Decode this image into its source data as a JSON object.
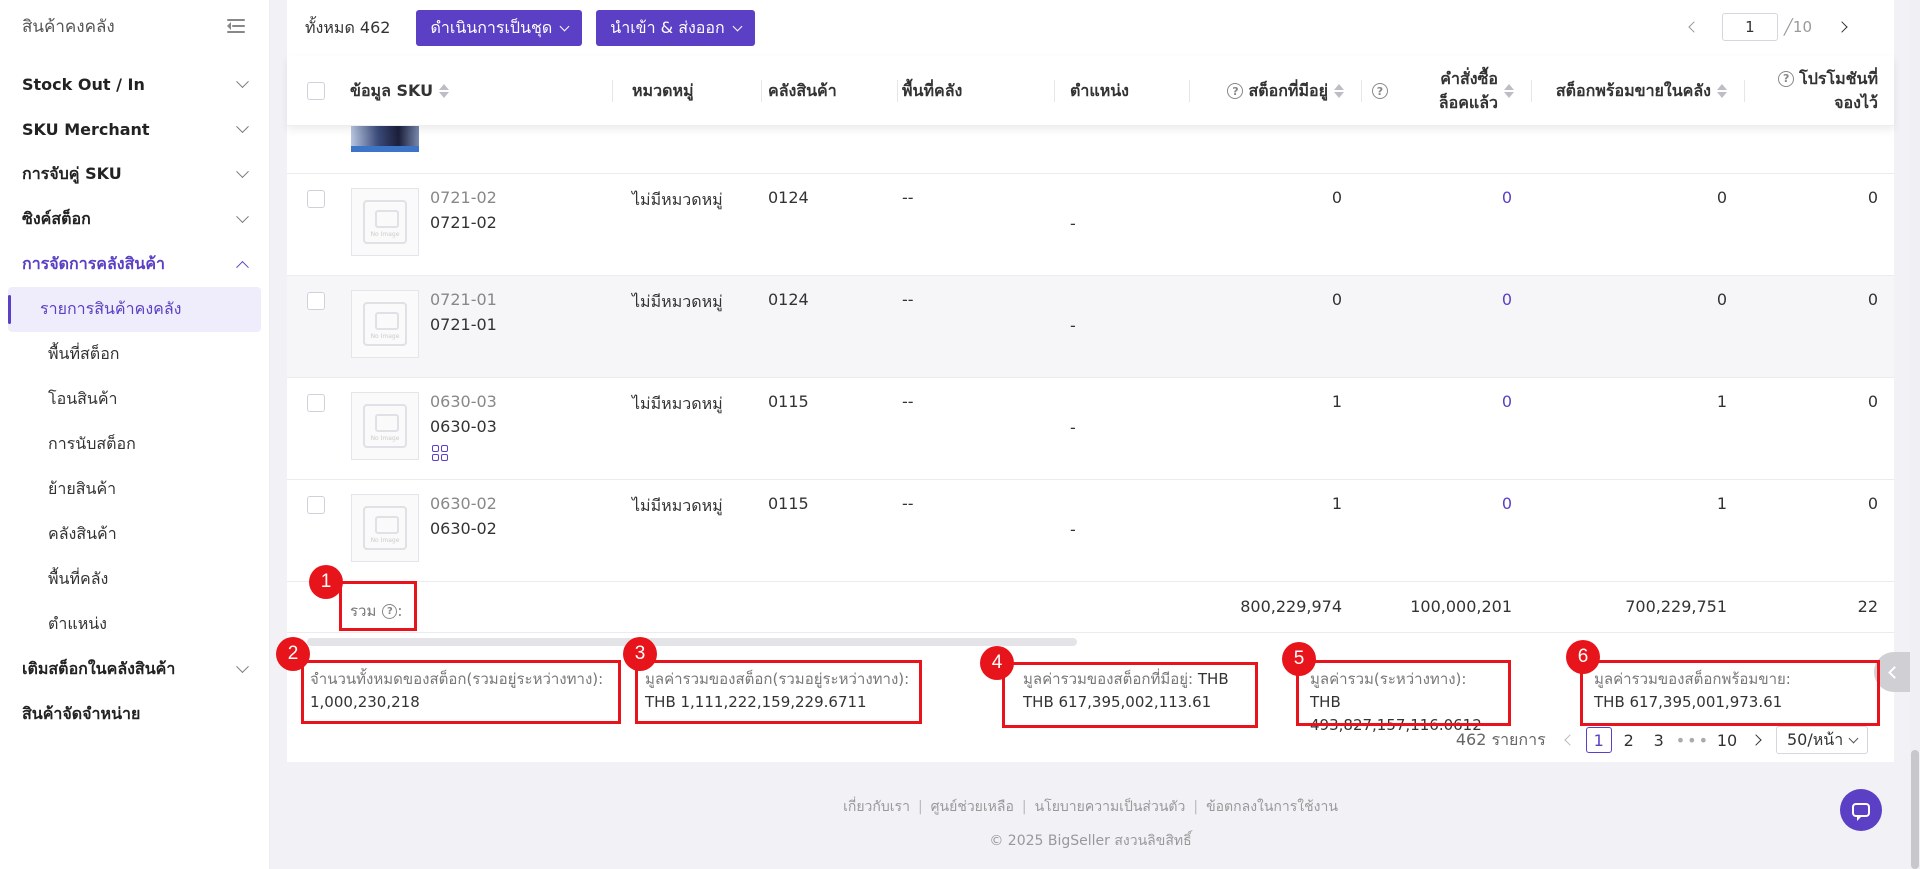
{
  "sidebar": {
    "title": "สินค้าคงคลัง",
    "groups": [
      {
        "label": "Stock Out / In"
      },
      {
        "label": "SKU Merchant"
      },
      {
        "label": "การจับคู่ SKU"
      },
      {
        "label": "ซิงค์สต็อก"
      },
      {
        "label": "การจัดการคลังสินค้า"
      }
    ],
    "sub_items": [
      {
        "label": "รายการสินค้าคงคลัง"
      },
      {
        "label": "พื้นที่สต็อก"
      },
      {
        "label": "โอนสินค้า"
      },
      {
        "label": "การนับสต็อก"
      },
      {
        "label": "ย้ายสินค้า"
      },
      {
        "label": "คลังสินค้า"
      },
      {
        "label": "พื้นที่คลัง"
      },
      {
        "label": "ตำแหน่ง"
      }
    ],
    "after_groups": [
      {
        "label": "เติมสต็อกในคลังสินค้า"
      },
      {
        "label": "สินค้าจัดจำหน่าย"
      }
    ]
  },
  "toolbar": {
    "total_label": "ทั้งหมด 462",
    "bulk_action": "ดำเนินการเป็นชุด",
    "import_export": "นำเข้า & ส่งออก",
    "current_page": "1",
    "total_pages": "╱10"
  },
  "table": {
    "headers": {
      "sku_info": "ข้อมูล SKU",
      "category": "หมวดหมู่",
      "warehouse": "คลังสินค้า",
      "area": "พื้นที่คลัง",
      "location": "ตำแหน่ง",
      "on_hand": "สต็อกที่มีอยู่",
      "locked_order_1": "คำสั่งซื้อ",
      "locked_order_2": "ล็อคแล้ว",
      "available": "สต็อกพร้อมขายในคลัง",
      "promo_1": "โปรโมชันที่",
      "promo_2": "จองไว้"
    },
    "rows": [
      {
        "sku_top": "0721-02",
        "sku_bottom": "0721-02",
        "category": "ไม่มีหมวดหมู่",
        "warehouse": "0124",
        "area": "--",
        "location": "-",
        "on_hand": "0",
        "locked": "0",
        "available": "0",
        "promo": "0"
      },
      {
        "sku_top": "0721-01",
        "sku_bottom": "0721-01",
        "category": "ไม่มีหมวดหมู่",
        "warehouse": "0124",
        "area": "--",
        "location": "-",
        "on_hand": "0",
        "locked": "0",
        "available": "0",
        "promo": "0"
      },
      {
        "sku_top": "0630-03",
        "sku_bottom": "0630-03",
        "category": "ไม่มีหมวดหมู่",
        "warehouse": "0115",
        "area": "--",
        "location": "-",
        "on_hand": "1",
        "locked": "0",
        "available": "1",
        "promo": "0"
      },
      {
        "sku_top": "0630-02",
        "sku_bottom": "0630-02",
        "category": "ไม่มีหมวดหมู่",
        "warehouse": "0115",
        "area": "--",
        "location": "-",
        "on_hand": "1",
        "locked": "0",
        "available": "1",
        "promo": "0"
      }
    ],
    "placeholder_text": "No Image",
    "summary": {
      "label": "รวม",
      "on_hand": "800,229,974",
      "locked": "100,000,201",
      "available": "700,229,751",
      "promo": "22"
    }
  },
  "stats": {
    "total_qty_label": "จำนวนทั้งหมดของสต็อก(รวมอยู่ระหว่างทาง):",
    "total_qty_value": "1,000,230,218",
    "total_value_label": "มูลค่ารวมของสต็อก(รวมอยู่ระหว่างทาง):",
    "total_value_value": "THB 1,111,222,159,229.6711",
    "on_hand_value_label": "มูลค่ารวมของสต็อกที่มีอยู่:",
    "on_hand_value_value": "THB 617,395,002,113.61",
    "in_transit_label": "มูลค่ารวม(ระหว่างทาง):",
    "in_transit_value": "THB 493,827,157,116.0612",
    "available_value_label": "มูลค่ารวมของสต็อกพร้อมขาย:",
    "available_value_value": "THB 617,395,001,973.61"
  },
  "pager": {
    "count": "462 รายการ",
    "pages": [
      "1",
      "2",
      "3",
      "•••",
      "10"
    ],
    "page_size": "50/หน้า"
  },
  "annotations": [
    "1",
    "2",
    "3",
    "4",
    "5",
    "6"
  ],
  "footer": {
    "links": [
      "เกี่ยวกับเรา",
      "ศูนย์ช่วยเหลือ",
      "นโยบายความเป็นส่วนตัว",
      "ข้อตกลงในการใช้งาน"
    ],
    "separator": "|",
    "copyright": "© 2025 BigSeller สงวนลิขสิทธิ์"
  },
  "colors": {
    "accent": "#5b3fc4",
    "annotation": "#e8141b"
  }
}
